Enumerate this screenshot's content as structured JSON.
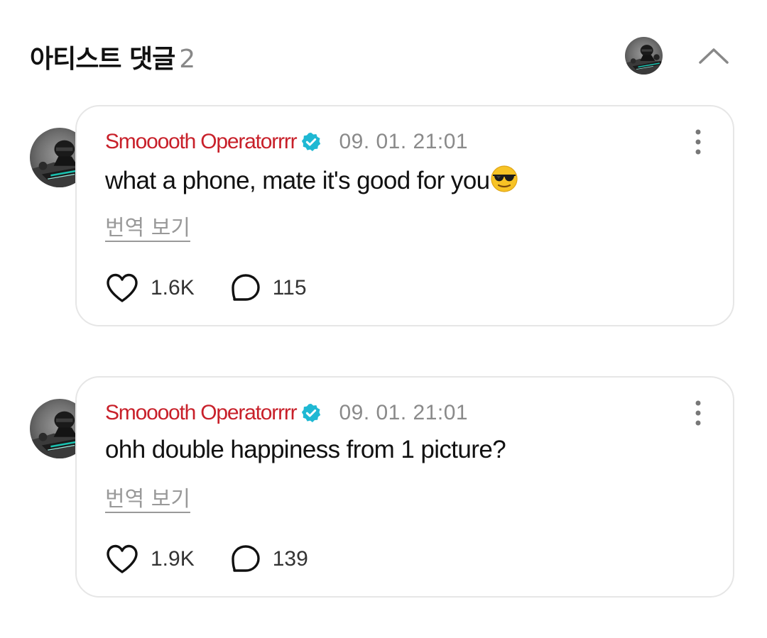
{
  "header": {
    "title": "아티스트 댓글",
    "count": "2"
  },
  "comments": [
    {
      "author": "Smooooth Operatorrrr",
      "timestamp": "09. 01. 21:01",
      "text": "what a phone, mate it's good for you",
      "emoji": "smiling-face-with-sunglasses",
      "translate_label": "번역 보기",
      "likes": "1.6K",
      "replies": "115"
    },
    {
      "author": "Smooooth Operatorrrr",
      "timestamp": "09. 01. 21:01",
      "text": "ohh double happiness from 1 picture?",
      "translate_label": "번역 보기",
      "likes": "1.9K",
      "replies": "139"
    }
  ],
  "colors": {
    "author": "#c8202a",
    "verified_badge": "#1fb8d3",
    "timestamp": "#8a8a8a",
    "card_border": "#e6e6e6"
  }
}
